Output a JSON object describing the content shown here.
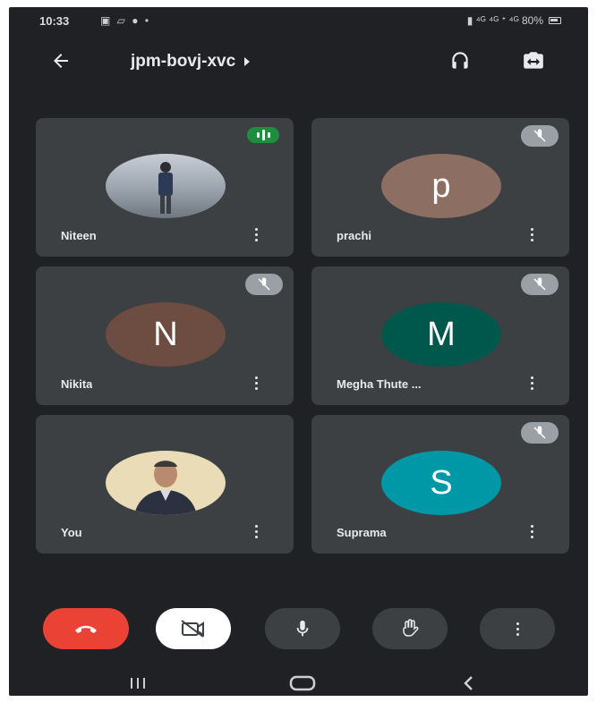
{
  "status_bar": {
    "time": "10:33",
    "left_icons": "▣ ▱ ● •",
    "right_text": "▮ ⁴ᴳ ⁴ᴳ ᐩ ⁴ᴳ 80%"
  },
  "header": {
    "meeting_code": "jpm-bovj-xvc"
  },
  "participants": [
    {
      "name": "Niteen",
      "initial": "",
      "avatar_color": "#8d949c",
      "status": "speaking"
    },
    {
      "name": "prachi",
      "initial": "p",
      "avatar_color": "#8d6e63",
      "status": "muted"
    },
    {
      "name": "Nikita",
      "initial": "N",
      "avatar_color": "#6d4c41",
      "status": "muted"
    },
    {
      "name": "Megha Thute ...",
      "initial": "M",
      "avatar_color": "#00574b",
      "status": "muted"
    },
    {
      "name": "You",
      "initial": "",
      "avatar_color": "#e9dcb6",
      "status": "none"
    },
    {
      "name": "Suprama",
      "initial": "S",
      "avatar_color": "#0097a7",
      "status": "muted"
    }
  ],
  "controls": [
    {
      "name": "end-call",
      "color": "#ea4335"
    },
    {
      "name": "camera-off",
      "color": "#ffffff"
    },
    {
      "name": "microphone",
      "color": "#3c4043"
    },
    {
      "name": "raise-hand",
      "color": "#3c4043"
    },
    {
      "name": "more-options",
      "color": "#3c4043"
    }
  ],
  "colors": {
    "background": "#202124",
    "tile": "#3c4043",
    "speaking": "#1e8e3e",
    "muted_badge": "#9aa0a6"
  }
}
